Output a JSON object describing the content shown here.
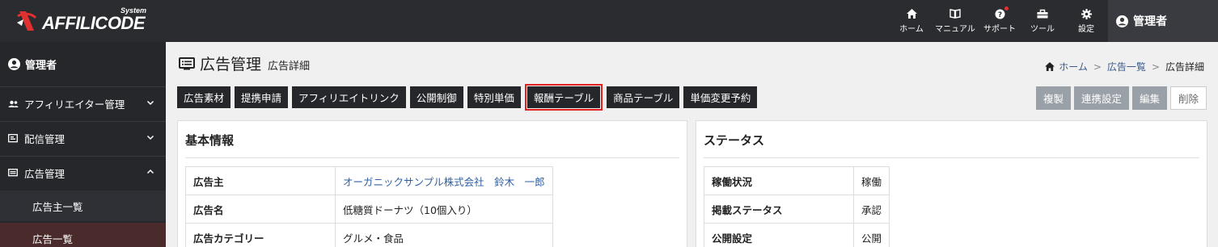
{
  "app": {
    "logo_text": "AFFILICODE",
    "logo_sub": "System"
  },
  "topnav": [
    {
      "label": "ホーム",
      "icon": "home-icon"
    },
    {
      "label": "マニュアル",
      "icon": "book-icon"
    },
    {
      "label": "サポート",
      "icon": "help-icon"
    },
    {
      "label": "ツール",
      "icon": "toolbox-icon"
    },
    {
      "label": "設定",
      "icon": "gear-icon"
    }
  ],
  "admin": {
    "label": "管理者"
  },
  "sidebar": {
    "user": "管理者",
    "items": [
      {
        "label": "アフィリエイター管理",
        "icon": "users-icon"
      },
      {
        "label": "配信管理",
        "icon": "delivery-icon"
      },
      {
        "label": "広告管理",
        "icon": "ad-icon"
      }
    ],
    "subitems": [
      {
        "label": "広告主一覧"
      },
      {
        "label": "広告一覧"
      }
    ]
  },
  "page": {
    "title": "広告管理",
    "subtitle": "広告詳細"
  },
  "breadcrumb": {
    "home": "ホーム",
    "list": "広告一覧",
    "current": "広告詳細"
  },
  "tabs": [
    {
      "label": "広告素材"
    },
    {
      "label": "提携申請"
    },
    {
      "label": "アフィリエイトリンク"
    },
    {
      "label": "公開制御"
    },
    {
      "label": "特別単価"
    },
    {
      "label": "報酬テーブル"
    },
    {
      "label": "商品テーブル"
    },
    {
      "label": "単価変更予約"
    }
  ],
  "actions": {
    "copy": "複製",
    "link_settings": "連携設定",
    "edit": "編集",
    "delete": "削除"
  },
  "basic_info": {
    "title": "基本情報",
    "rows": [
      {
        "key": "広告主",
        "value": "オーガニックサンプル株式会社　鈴木　一郎"
      },
      {
        "key": "広告名",
        "value": "低糖質ドーナツ（10個入り）"
      },
      {
        "key": "広告カテゴリー",
        "value": "グルメ・食品"
      }
    ]
  },
  "status": {
    "title": "ステータス",
    "rows": [
      {
        "key": "稼働状況",
        "value": "稼働"
      },
      {
        "key": "掲載ステータス",
        "value": "承認"
      },
      {
        "key": "公開設定",
        "value": "公開"
      }
    ]
  },
  "colors": {
    "topbar": "#2b2c30",
    "sidebar": "#26272b",
    "highlight": "#e02020",
    "link": "#2f5fa0"
  }
}
